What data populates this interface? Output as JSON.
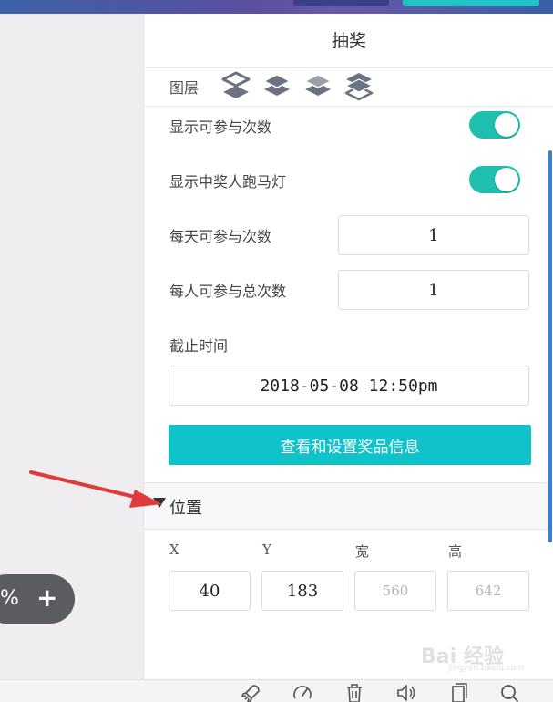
{
  "colors": {
    "accent_teal": "#10c2c9",
    "toggle_on": "#1fbfb0",
    "top_dark_button": "#3a3f8a",
    "annotation_arrow": "#e03a3a",
    "scrollbar": "#3b7fd4"
  },
  "canvas": {
    "zoom_percent": "%",
    "zoom_in_symbol": "+"
  },
  "panel": {
    "title": "抽奖",
    "layers": {
      "label": "图层",
      "icons": [
        "bring-to-front-icon",
        "bring-forward-icon",
        "send-backward-icon",
        "send-to-back-icon"
      ]
    },
    "show_attempts": {
      "label": "显示可参与次数",
      "on": true
    },
    "show_winners_marquee": {
      "label": "显示中奖人跑马灯",
      "on": true
    },
    "daily_attempts": {
      "label": "每天可参与次数",
      "value": "1"
    },
    "total_attempts": {
      "label": "每人可参与总次数",
      "value": "1"
    },
    "deadline": {
      "label": "截止时间",
      "value": "2018-05-08 12:50pm"
    },
    "prize_button": "查看和设置奖品信息",
    "position_section": {
      "title": "位置",
      "x_label": "X",
      "y_label": "Y",
      "width_label": "宽",
      "height_label": "高",
      "x_value": "40",
      "y_value": "183",
      "width_value": "560",
      "height_value": "642"
    }
  },
  "toolbar": {
    "icons": [
      "rocket-icon",
      "speed-icon",
      "trash-icon",
      "sound-icon",
      "copy-icon",
      "search-icon"
    ]
  },
  "watermark": {
    "text": "Bai 经验",
    "sub": "jingyan.baidu.com"
  }
}
